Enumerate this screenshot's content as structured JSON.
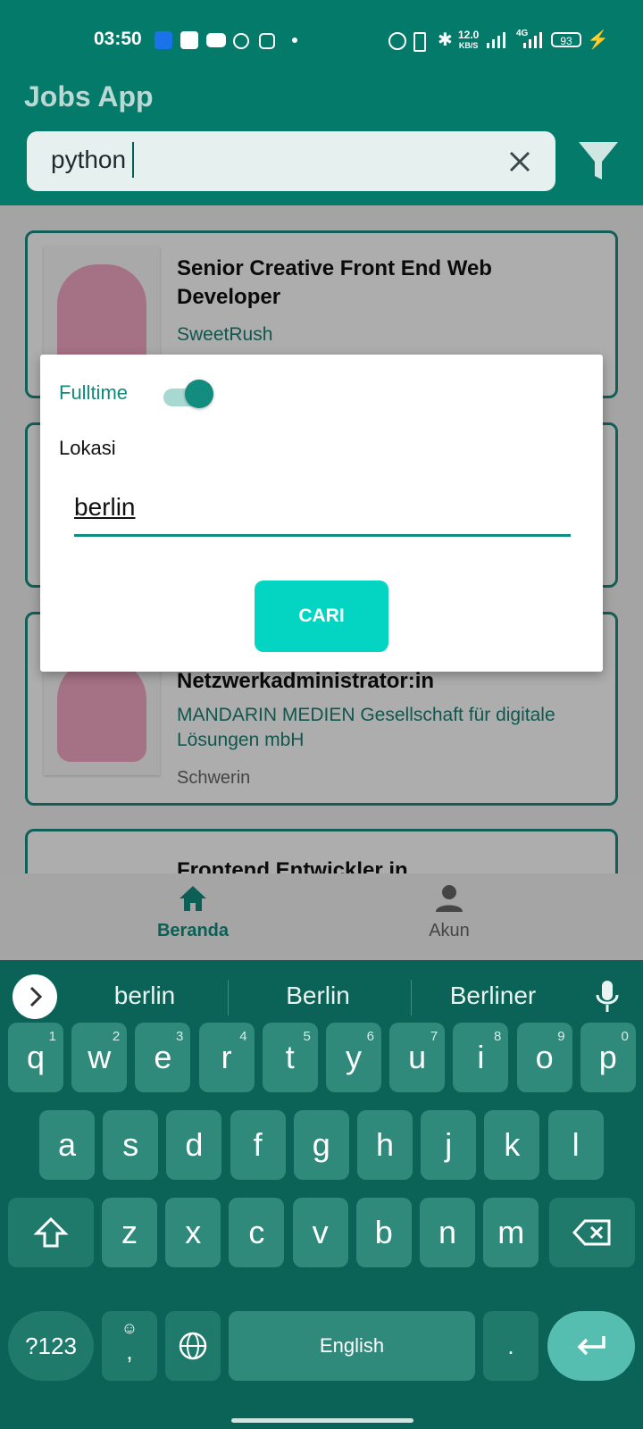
{
  "status_bar": {
    "time": "03:50",
    "net_speed": "12.0",
    "net_unit": "KB/S",
    "network": "4G",
    "battery": "93"
  },
  "app": {
    "title": "Jobs App",
    "search": {
      "value": "python"
    }
  },
  "jobs": [
    {
      "title": "Senior Creative Front End Web Developer",
      "company": "SweetRush",
      "location": ""
    },
    {
      "title": "Netzwerkadministrator:in",
      "company": "MANDARIN MEDIEN Gesellschaft für digitale Lösungen mbH",
      "location": "Schwerin"
    },
    {
      "title": "Frontend Entwickler in",
      "company": "",
      "location": ""
    }
  ],
  "bottom_nav": [
    {
      "label": "Beranda",
      "icon": "home-icon",
      "active": true
    },
    {
      "label": "Akun",
      "icon": "person-icon",
      "active": false
    }
  ],
  "filter_dialog": {
    "fulltime_label": "Fulltime",
    "fulltime_on": true,
    "location_label": "Lokasi",
    "location_value": "berlin",
    "submit_label": "CARI"
  },
  "keyboard": {
    "suggestions": [
      "berlin",
      "Berlin",
      "Berliner"
    ],
    "row1": [
      {
        "k": "q",
        "h": "1"
      },
      {
        "k": "w",
        "h": "2"
      },
      {
        "k": "e",
        "h": "3"
      },
      {
        "k": "r",
        "h": "4"
      },
      {
        "k": "t",
        "h": "5"
      },
      {
        "k": "y",
        "h": "6"
      },
      {
        "k": "u",
        "h": "7"
      },
      {
        "k": "i",
        "h": "8"
      },
      {
        "k": "o",
        "h": "9"
      },
      {
        "k": "p",
        "h": "0"
      }
    ],
    "row2": [
      "a",
      "s",
      "d",
      "f",
      "g",
      "h",
      "j",
      "k",
      "l"
    ],
    "row3": [
      "z",
      "x",
      "c",
      "v",
      "b",
      "n",
      "m"
    ],
    "symbols_label": "?123",
    "comma_label": ",",
    "space_label": "English",
    "period_label": "."
  },
  "colors": {
    "primary": "#047a6b",
    "accent": "#03d5c2",
    "keyboard_bg": "#0a6356",
    "key_bg": "#2f8a7c"
  }
}
